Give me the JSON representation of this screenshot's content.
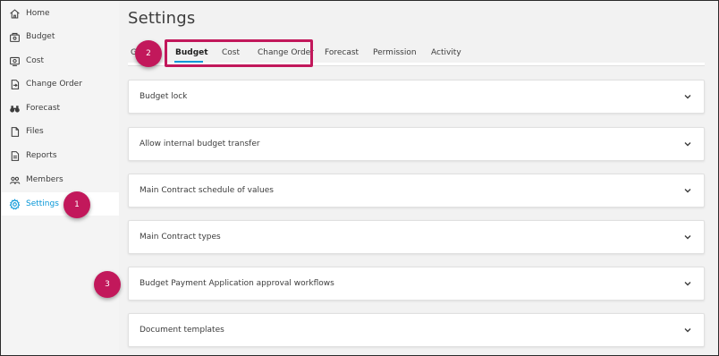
{
  "sidebar": {
    "items": [
      {
        "label": "Home",
        "icon": "home-icon"
      },
      {
        "label": "Budget",
        "icon": "budget-icon"
      },
      {
        "label": "Cost",
        "icon": "cost-icon"
      },
      {
        "label": "Change Order",
        "icon": "change-order-icon"
      },
      {
        "label": "Forecast",
        "icon": "forecast-icon"
      },
      {
        "label": "Files",
        "icon": "files-icon"
      },
      {
        "label": "Reports",
        "icon": "reports-icon"
      },
      {
        "label": "Members",
        "icon": "members-icon"
      },
      {
        "label": "Settings",
        "icon": "gear-icon",
        "active": true
      }
    ]
  },
  "main": {
    "title": "Settings",
    "tabs": [
      {
        "label": "G"
      },
      {
        "label": "Budget",
        "active": true
      },
      {
        "label": "Cost"
      },
      {
        "label": "Change Order"
      },
      {
        "label": "Forecast"
      },
      {
        "label": "Permission"
      },
      {
        "label": "Activity"
      }
    ],
    "panels": [
      {
        "label": "Budget lock"
      },
      {
        "label": "Allow internal budget transfer"
      },
      {
        "label": "Main Contract schedule of values"
      },
      {
        "label": "Main Contract types"
      },
      {
        "label": "Budget Payment Application approval workflows"
      },
      {
        "label": "Document templates"
      }
    ]
  },
  "annotations": {
    "callouts": [
      "1",
      "2",
      "3"
    ]
  },
  "colors": {
    "accent": "#0696d7",
    "annotation": "#c2185b"
  }
}
